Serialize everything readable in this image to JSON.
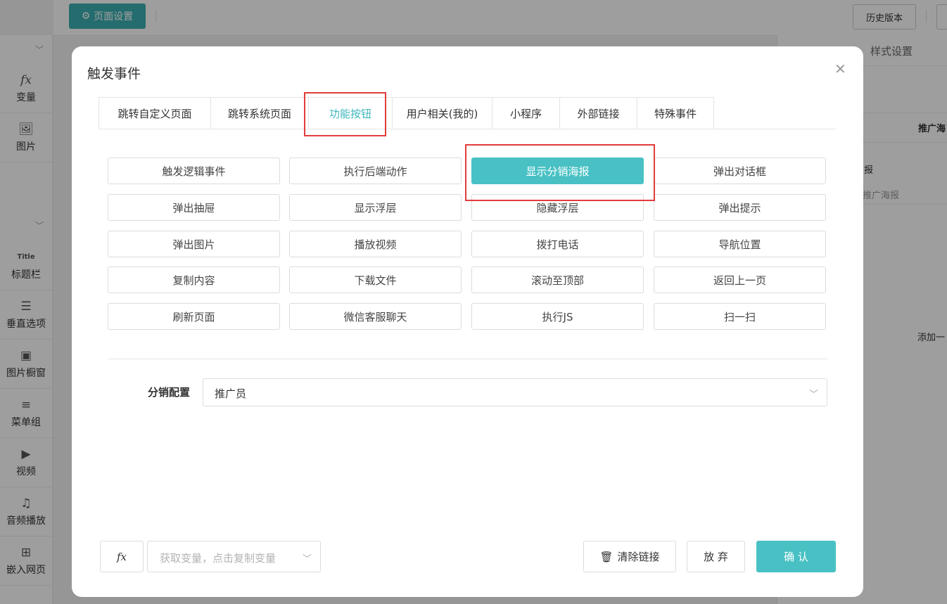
{
  "topbar": {
    "page_settings": "页面设置",
    "history": "历史版本"
  },
  "sidebar": {
    "items": [
      {
        "icon": "fx-icon",
        "label": "变量"
      },
      {
        "icon": "image-icon",
        "label": "图片"
      },
      {
        "icon": "title-icon",
        "label": "标题栏"
      },
      {
        "icon": "list-icon",
        "label": "垂直选项"
      },
      {
        "icon": "gallery-icon",
        "label": "图片橱窗"
      },
      {
        "icon": "menu-icon",
        "label": "菜单组"
      },
      {
        "icon": "video-icon",
        "label": "视频"
      },
      {
        "icon": "music-icon",
        "label": "音频播放"
      },
      {
        "icon": "embed-icon",
        "label": "嵌入网页"
      }
    ],
    "title_icon_text": "Title"
  },
  "right_panel": {
    "tab": "样式设置",
    "row1": "推广海",
    "row2": "报",
    "row3": "推广海报",
    "row4": "添加一"
  },
  "modal": {
    "title": "触发事件",
    "tabs": [
      {
        "label": "跳转自定义页面"
      },
      {
        "label": "跳转系统页面"
      },
      {
        "label": "功能按钮",
        "active": true
      },
      {
        "label": "用户相关(我的)"
      },
      {
        "label": "小程序"
      },
      {
        "label": "外部链接"
      },
      {
        "label": "特殊事件"
      }
    ],
    "actions": [
      "触发逻辑事件",
      "执行后端动作",
      "显示分销海报",
      "弹出对话框",
      "弹出抽屉",
      "显示浮层",
      "隐藏浮层",
      "弹出提示",
      "弹出图片",
      "播放视频",
      "拨打电话",
      "导航位置",
      "复制内容",
      "下载文件",
      "滚动至顶部",
      "返回上一页",
      "刷新页面",
      "微信客服聊天",
      "执行JS",
      "扫一扫"
    ],
    "selected_action": "显示分销海报",
    "config": {
      "label": "分销配置",
      "value": "推广员"
    },
    "footer": {
      "fx": "fx",
      "var_placeholder": "获取变量，点击复制变量",
      "clear": "清除链接",
      "cancel": "放 弃",
      "confirm": "确 认"
    }
  }
}
